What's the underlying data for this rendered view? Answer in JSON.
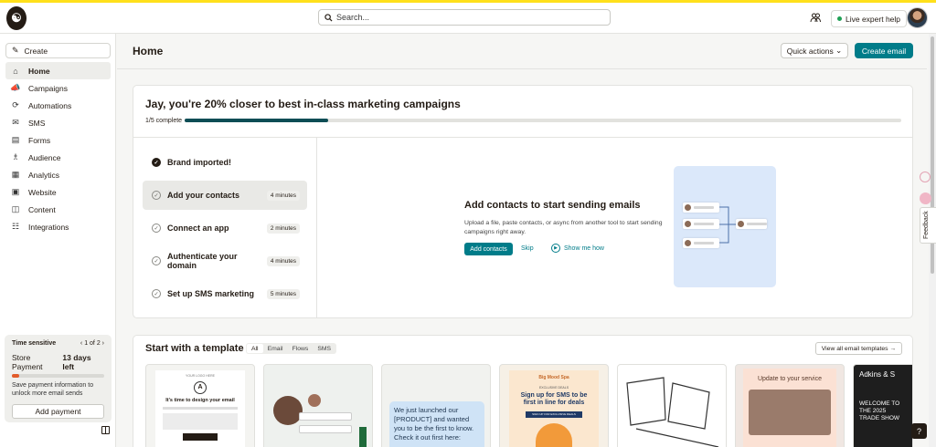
{
  "topbar": {
    "search_placeholder": "Search...",
    "expert_label": "Live expert help"
  },
  "sidebar": {
    "create_label": "Create",
    "items": [
      {
        "label": "Home",
        "icon": "home-icon"
      },
      {
        "label": "Campaigns",
        "icon": "megaphone-icon"
      },
      {
        "label": "Automations",
        "icon": "automation-icon"
      },
      {
        "label": "SMS",
        "icon": "sms-icon"
      },
      {
        "label": "Forms",
        "icon": "forms-icon"
      },
      {
        "label": "Audience",
        "icon": "audience-icon"
      },
      {
        "label": "Analytics",
        "icon": "analytics-icon"
      },
      {
        "label": "Website",
        "icon": "website-icon"
      },
      {
        "label": "Content",
        "icon": "content-icon"
      },
      {
        "label": "Integrations",
        "icon": "integrations-icon"
      }
    ],
    "time_sensitive": {
      "heading": "Time sensitive",
      "pager": "1 of 2",
      "title": "Store Payment",
      "days_left": "13 days left",
      "progress": 0.08,
      "description": "Save payment information to unlock more email sends",
      "button": "Add payment"
    }
  },
  "header": {
    "title": "Home",
    "quick_actions": "Quick actions",
    "create_email": "Create email"
  },
  "progress": {
    "title": "Jay, you're 20% closer to best in-class marketing campaigns",
    "count": "1/5 complete",
    "fraction": 0.2,
    "steps": [
      {
        "label": "Brand imported!",
        "duration": "",
        "done": true,
        "active": false
      },
      {
        "label": "Add your contacts",
        "duration": "4 minutes",
        "done": false,
        "active": true
      },
      {
        "label": "Connect an app",
        "duration": "2 minutes",
        "done": false,
        "active": false
      },
      {
        "label": "Authenticate your domain",
        "duration": "4 minutes",
        "done": false,
        "active": false
      },
      {
        "label": "Set up SMS marketing",
        "duration": "5 minutes",
        "done": false,
        "active": false
      }
    ],
    "detail": {
      "title": "Add contacts to start sending emails",
      "description": "Upload a file, paste contacts, or async from another tool to start sending campaigns right away.",
      "primary": "Add contacts",
      "skip": "Skip",
      "show_me": "Show me how"
    }
  },
  "templates": {
    "title": "Start with a template",
    "tabs": [
      "All",
      "Email",
      "Flows",
      "SMS"
    ],
    "view_all": "View all email templates",
    "cards": [
      {
        "headline": "It's time to design your email",
        "logo": "YOUR LOGO HERE",
        "letter": "A"
      },
      {
        "headline": ""
      },
      {
        "headline": "We just launched our [PRODUCT] and wanted you to be the first to know. Check it out first here:"
      },
      {
        "brand": "Big Mood Spa",
        "kicker": "EXCLUSIVE DEALS",
        "headline": "Sign up for SMS to be first in line for deals",
        "cta": "SIGN UP FOR EXCLUSIVE DEALS"
      },
      {
        "headline": ""
      },
      {
        "headline": "Update to your service"
      },
      {
        "brand": "Adkins & S",
        "headline": "WELCOME TO THE 2025 TRADE SHOW"
      }
    ]
  },
  "side": {
    "feedback": "Feedback",
    "help": "?"
  }
}
